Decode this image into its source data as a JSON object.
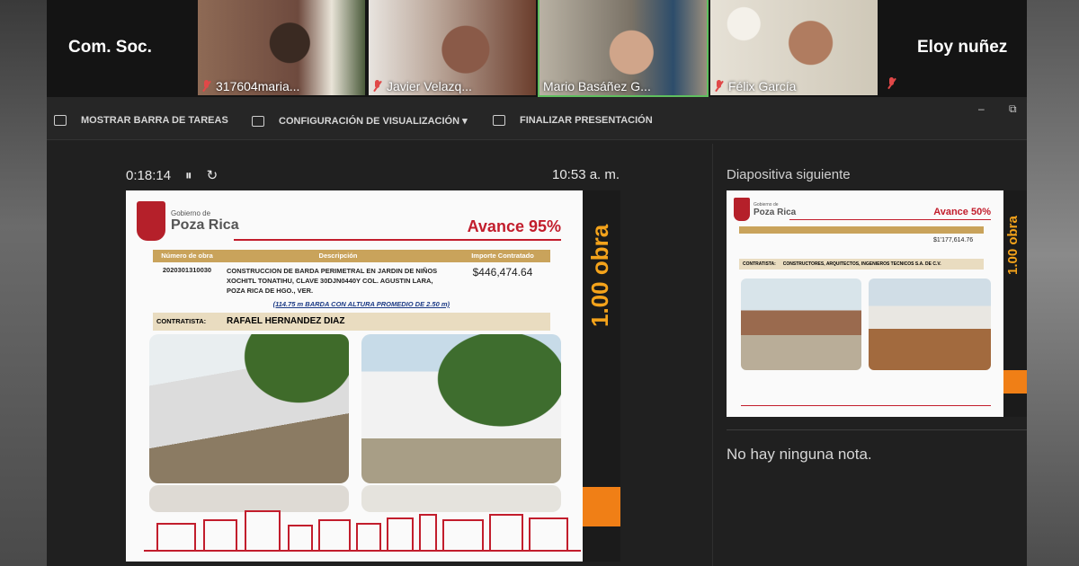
{
  "participants": {
    "left_label": "Com. Soc.",
    "right_label": "Eloy nuñez",
    "tiles": [
      {
        "name": "317604maria...",
        "muted": true
      },
      {
        "name": "Javier Velazq...",
        "muted": true
      },
      {
        "name": "Mario Basáñez G...",
        "muted": false
      },
      {
        "name": "Félix García",
        "muted": true
      }
    ]
  },
  "toolbar": {
    "taskbar_label": "MOSTRAR BARRA DE TAREAS",
    "display_settings_label": "CONFIGURACIÓN DE VISUALIZACIÓN ▾",
    "end_presentation_label": "FINALIZAR PRESENTACIÓN",
    "minimize": "–",
    "restore": "⧉"
  },
  "presenter": {
    "elapsed": "0:18:14",
    "pause_icon": "⏸",
    "reset_icon": "↻",
    "clock": "10:53 a. m."
  },
  "current_slide": {
    "gov_label": "Gobierno de",
    "city": "Poza Rica",
    "avance": "Avance 95%",
    "side_label": "1.00 obra",
    "headers": [
      "Número de obra",
      "Descripción",
      "Importe Contratado"
    ],
    "obra_num": "2020301310030",
    "description": "CONSTRUCCION DE BARDA PERIMETRAL EN JARDIN DE NIÑOS XOCHITL TONATIHU, CLAVE 30DJN0440Y COL. AGUSTIN LARA, POZA RICA DE HGO., VER.",
    "note": "(114.75 m BARDA CON ALTURA PROMEDIO DE 2.50 m)",
    "amount": "$446,474.64",
    "contractor_label": "CONTRATISTA:",
    "contractor": "RAFAEL HERNANDEZ DIAZ"
  },
  "next_panel": {
    "title": "Diapositiva siguiente",
    "gov_label": "Gobierno de",
    "city": "Poza Rica",
    "avance": "Avance 50%",
    "side_label": "1.00 obra",
    "amount": "$1'177,614.76",
    "contractor_label": "CONTRATISTA:",
    "contractor": "CONSTRUCTORES, ARQUITECTOS, INGENIEROS TECNICOS S.A. DE C.V.",
    "notes": "No hay ninguna nota."
  }
}
